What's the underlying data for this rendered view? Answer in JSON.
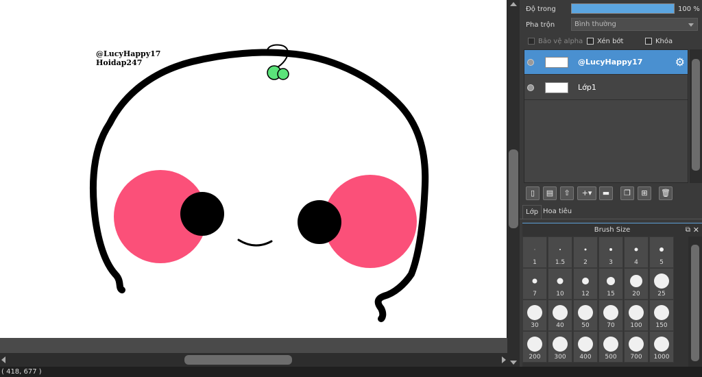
{
  "canvas": {
    "watermark_line1": "@LucyHappy17",
    "watermark_line2": "Hoidap247",
    "colors": {
      "blush": "#fb5079",
      "outline": "#000000",
      "leaf": "#5be37a"
    }
  },
  "status": {
    "coords": "( 418, 677 )"
  },
  "layer_props": {
    "opacity_label": "Độ trong",
    "opacity_value": "100 %",
    "opacity_level": 1.0,
    "blend_label": "Pha trộn",
    "blend_value": "Bình thường",
    "protect_alpha_label": "Bảo vệ alpha",
    "clip_label": "Xén bớt",
    "lock_label": "Khóa"
  },
  "layers": [
    {
      "name": "@LucyHappy17",
      "selected": true
    },
    {
      "name": "Lớp1",
      "selected": false
    }
  ],
  "layer_toolbar": {
    "icons": [
      "new-layer-icon",
      "new-raster-icon",
      "import-layer-icon",
      "add-layer-menu-icon",
      "folder-icon",
      "duplicate-icon",
      "merge-icon",
      "delete-icon"
    ]
  },
  "tabs": [
    {
      "label": "Lớp",
      "active": true
    },
    {
      "label": "Hoa tiêu",
      "active": false
    }
  ],
  "brush_panel": {
    "title": "Brush Size",
    "sizes": [
      "1",
      "1.5",
      "2",
      "3",
      "4",
      "5",
      "7",
      "10",
      "12",
      "15",
      "20",
      "25",
      "30",
      "40",
      "50",
      "70",
      "100",
      "150",
      "200",
      "300",
      "400",
      "500",
      "700",
      "1000"
    ]
  },
  "colors": {
    "accent": "#4a90d0",
    "panel_bg": "#3a3a3a"
  }
}
